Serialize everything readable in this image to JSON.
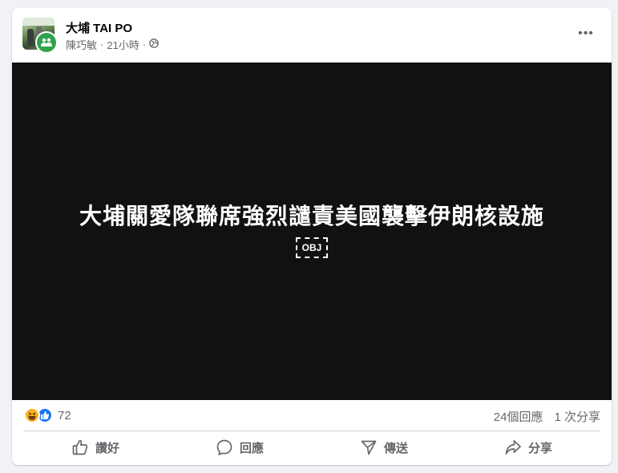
{
  "post": {
    "page_name": "大埔 TAI PO",
    "author": "陳巧敏",
    "time": "21小時",
    "separator": "·",
    "privacy_icon": "globe-icon",
    "more_label": "•••"
  },
  "media": {
    "headline": "大埔關愛隊聯席強烈譴責美國襲擊伊朗核設施",
    "obj_label": "OBJ"
  },
  "stats": {
    "reaction_icons": [
      "haha-icon",
      "like-icon"
    ],
    "reaction_count": "72",
    "comments": "24個回應",
    "shares": "1 次分享"
  },
  "actions": {
    "like": "讚好",
    "comment": "回應",
    "send": "傳送",
    "share": "分享"
  },
  "colors": {
    "accent": "#1877f2",
    "group_badge": "#31a24c",
    "media_bg": "#111111",
    "muted_text": "#65676b"
  }
}
